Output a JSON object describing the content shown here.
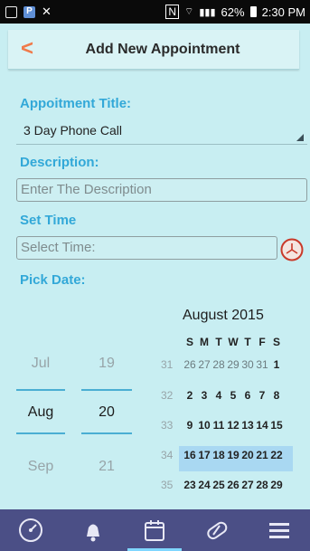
{
  "status_bar": {
    "battery": "62%",
    "time": "2:30 PM",
    "left_icons": [
      "notification-icon",
      "p-icon",
      "missed-call-icon"
    ],
    "right_icons": [
      "nfc-icon",
      "wifi-icon",
      "lte-signal-icon",
      "battery-icon"
    ]
  },
  "header": {
    "back_symbol": "<",
    "title": "Add New Appointment"
  },
  "form": {
    "title_label": "Appoitment Title:",
    "title_value": "3 Day Phone Call",
    "description_label": "Description:",
    "description_placeholder": "Enter The Description",
    "time_label": "Set Time",
    "time_placeholder": "Select Time:",
    "date_label": "Pick Date:"
  },
  "date_picker": {
    "months": [
      "Jul",
      "Aug",
      "Sep"
    ],
    "days": [
      "19",
      "20",
      "21"
    ],
    "selected_month": "Aug",
    "selected_day": "20"
  },
  "calendar": {
    "title": "August 2015",
    "weekdays": [
      "S",
      "M",
      "T",
      "W",
      "T",
      "F",
      "S"
    ],
    "weeks": [
      {
        "num": "31",
        "days": [
          "26",
          "27",
          "28",
          "29",
          "30",
          "31",
          "1"
        ]
      },
      {
        "num": "32",
        "days": [
          "2",
          "3",
          "4",
          "5",
          "6",
          "7",
          "8"
        ]
      },
      {
        "num": "33",
        "days": [
          "9",
          "10",
          "11",
          "12",
          "13",
          "14",
          "15"
        ]
      },
      {
        "num": "34",
        "days": [
          "16",
          "17",
          "18",
          "19",
          "20",
          "21",
          "22"
        ]
      },
      {
        "num": "35",
        "days": [
          "23",
          "24",
          "25",
          "26",
          "27",
          "28",
          "29"
        ]
      }
    ],
    "selected_date": "20"
  },
  "nav": {
    "items": [
      "speedometer-icon",
      "bell-icon",
      "calendar-icon",
      "pill-icon",
      "menu-icon"
    ],
    "active": "calendar-icon"
  },
  "colors": {
    "accent": "#32a8d8",
    "back": "#f07a4a",
    "nav_bg": "#4b4f86",
    "page_bg": "#c8eef2",
    "selected_week": "#a9d8f2"
  }
}
